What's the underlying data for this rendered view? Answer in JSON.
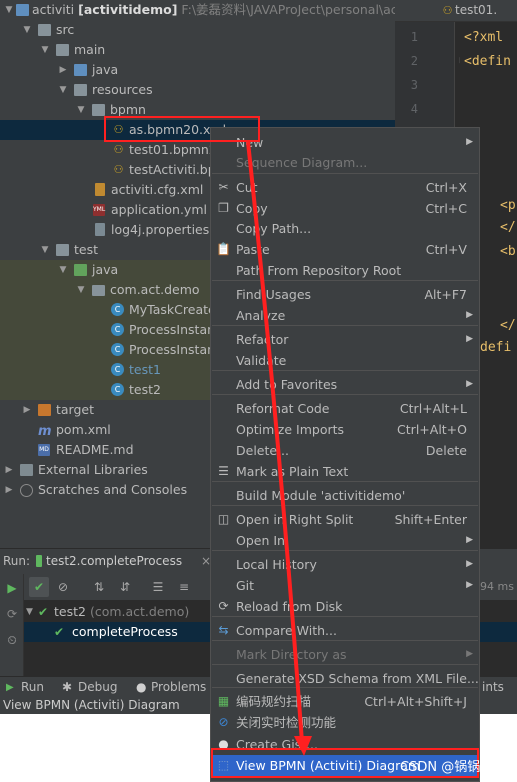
{
  "project": {
    "root_name": "activiti",
    "root_module": "[activitidemo]",
    "root_path": "F:\\姜磊资料\\JAVAProJect\\personal\\acti",
    "items": [
      {
        "label": "src"
      },
      {
        "label": "main"
      },
      {
        "label": "java"
      },
      {
        "label": "resources"
      },
      {
        "label": "bpmn"
      },
      {
        "label": "as.bpmn20.xml"
      },
      {
        "label": "test01.bpmn20"
      },
      {
        "label": "testActiviti.bpr"
      },
      {
        "label": "activiti.cfg.xml"
      },
      {
        "label": "application.yml"
      },
      {
        "label": "log4j.properties"
      },
      {
        "label": "test"
      },
      {
        "label": "java"
      },
      {
        "label": "com.act.demo"
      },
      {
        "label": "MyTaskCreate"
      },
      {
        "label": "ProcessInstan"
      },
      {
        "label": "ProcessInstan"
      },
      {
        "label": "test1"
      },
      {
        "label": "test2"
      },
      {
        "label": "target"
      },
      {
        "label": "pom.xml"
      },
      {
        "label": "README.md"
      },
      {
        "label": "External Libraries"
      },
      {
        "label": "Scratches and Consoles"
      }
    ]
  },
  "editor": {
    "tab_label": "test01.",
    "line_numbers": [
      "1",
      "2",
      "3",
      "4"
    ],
    "code_lines": [
      "<?xml",
      "<defin",
      "<p",
      "</",
      "<b",
      "</",
      "defi"
    ]
  },
  "run": {
    "label": "Run:",
    "tab_label": "test2.completeProcess",
    "close": "×",
    "duration": "94 ms",
    "tree": [
      {
        "label": "test2",
        "detail": "(com.act.demo)"
      },
      {
        "label": "completeProcess"
      }
    ]
  },
  "bottom_tabs": [
    {
      "label": "Run"
    },
    {
      "label": "Debug"
    },
    {
      "label": "Problems"
    },
    {
      "label": "ints"
    }
  ],
  "status": {
    "text": "View BPMN (Activiti) Diagram"
  },
  "context_menu": {
    "items": [
      {
        "label": "New",
        "shortcut": "",
        "submenu": true,
        "disabled": false
      },
      {
        "label": "Sequence Diagram...",
        "shortcut": "",
        "submenu": false,
        "disabled": true
      },
      {
        "label": "Cut",
        "shortcut": "Ctrl+X",
        "submenu": false,
        "disabled": false
      },
      {
        "label": "Copy",
        "shortcut": "Ctrl+C",
        "submenu": false,
        "disabled": false
      },
      {
        "label": "Copy Path...",
        "shortcut": "",
        "submenu": false,
        "disabled": false
      },
      {
        "label": "Paste",
        "shortcut": "Ctrl+V",
        "submenu": false,
        "disabled": false
      },
      {
        "label": "Path From Repository Root",
        "shortcut": "",
        "submenu": false,
        "disabled": false
      },
      {
        "label": "Find Usages",
        "shortcut": "Alt+F7",
        "submenu": false,
        "disabled": false
      },
      {
        "label": "Analyze",
        "shortcut": "",
        "submenu": true,
        "disabled": false
      },
      {
        "label": "Refactor",
        "shortcut": "",
        "submenu": true,
        "disabled": false
      },
      {
        "label": "Validate",
        "shortcut": "",
        "submenu": false,
        "disabled": false
      },
      {
        "label": "Add to Favorites",
        "shortcut": "",
        "submenu": true,
        "disabled": false
      },
      {
        "label": "Reformat Code",
        "shortcut": "Ctrl+Alt+L",
        "submenu": false,
        "disabled": false
      },
      {
        "label": "Optimize Imports",
        "shortcut": "Ctrl+Alt+O",
        "submenu": false,
        "disabled": false
      },
      {
        "label": "Delete...",
        "shortcut": "Delete",
        "submenu": false,
        "disabled": false
      },
      {
        "label": "Mark as Plain Text",
        "shortcut": "",
        "submenu": false,
        "disabled": false
      },
      {
        "label": "Build Module 'activitidemo'",
        "shortcut": "",
        "submenu": false,
        "disabled": false
      },
      {
        "label": "Open in Right Split",
        "shortcut": "Shift+Enter",
        "submenu": false,
        "disabled": false
      },
      {
        "label": "Open In",
        "shortcut": "",
        "submenu": true,
        "disabled": false
      },
      {
        "label": "Local History",
        "shortcut": "",
        "submenu": true,
        "disabled": false
      },
      {
        "label": "Git",
        "shortcut": "",
        "submenu": true,
        "disabled": false
      },
      {
        "label": "Reload from Disk",
        "shortcut": "",
        "submenu": false,
        "disabled": false
      },
      {
        "label": "Compare With...",
        "shortcut": "",
        "submenu": false,
        "disabled": false
      },
      {
        "label": "Mark Directory as",
        "shortcut": "",
        "submenu": true,
        "disabled": true
      },
      {
        "label": "Generate XSD Schema from XML File...",
        "shortcut": "",
        "submenu": false,
        "disabled": false
      },
      {
        "label": "编码规约扫描",
        "shortcut": "Ctrl+Alt+Shift+J",
        "submenu": false,
        "disabled": false
      },
      {
        "label": "关闭实时检测功能",
        "shortcut": "",
        "submenu": false,
        "disabled": false
      },
      {
        "label": "Create Gist...",
        "shortcut": "",
        "submenu": false,
        "disabled": false
      },
      {
        "label": "View BPMN (Activiti) Diagram",
        "shortcut": "",
        "submenu": false,
        "disabled": false
      }
    ]
  },
  "watermark": "CSDN @锅锅嗨",
  "colors": {
    "highlight": "#2f65ca",
    "annotation_red": "#ff2020",
    "panel_bg": "#3c3f41",
    "editor_bg": "#2b2b2b"
  }
}
